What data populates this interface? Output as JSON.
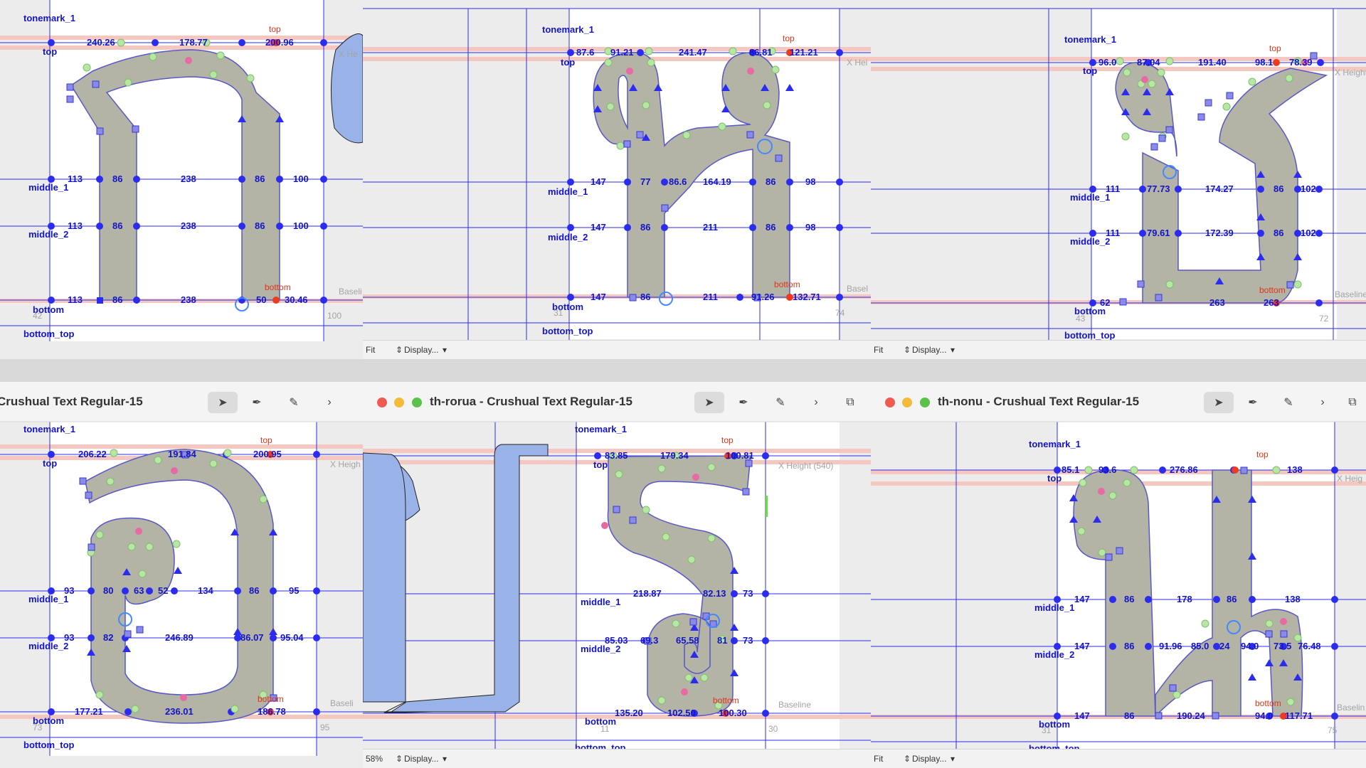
{
  "panels": [
    {
      "id": "p1",
      "has_titlebar": false,
      "guides": {
        "tonemark": "tonemark_1",
        "top": "top",
        "middle1": "middle_1",
        "middle2": "middle_2",
        "bottom": "bottom",
        "bottom_top": "bottom_top"
      },
      "anchor_labels": {
        "top": "top",
        "bottom": "bottom"
      },
      "metrics": [
        "240.26",
        "178.77",
        "200.96",
        "113",
        "86",
        "238",
        "86",
        "100",
        "113",
        "86",
        "238",
        "86",
        "100",
        "113",
        "86",
        "238",
        "50",
        "30.46"
      ],
      "side_labels": [
        "Baseli",
        "X He"
      ],
      "bottom_numbers": [
        "42",
        "100"
      ]
    },
    {
      "id": "p2",
      "has_titlebar": false,
      "guides": {
        "tonemark": "tonemark_1",
        "top": "top",
        "middle1": "middle_1",
        "middle2": "middle_2",
        "bottom": "bottom",
        "bottom_top": "bottom_top"
      },
      "anchor_labels": {
        "top": "top",
        "bottom": "bottom"
      },
      "metrics": [
        "87.6",
        "91.21",
        "241.47",
        "86.81",
        "121.21",
        "147",
        "77",
        "86.6",
        "164.19",
        "86",
        "98",
        "147",
        "86",
        "211",
        "86",
        "98",
        "147",
        "86",
        "211",
        "91.26",
        "132.71"
      ],
      "side_labels": [
        "X Hei",
        "Basel"
      ],
      "bottom_numbers": [
        "31",
        "74"
      ],
      "status": {
        "zoom": "Fit",
        "display": "Display..."
      }
    },
    {
      "id": "p3",
      "has_titlebar": false,
      "guides": {
        "tonemark": "tonemark_1",
        "top": "top",
        "middle1": "middle_1",
        "middle2": "middle_2",
        "bottom": "bottom",
        "bottom_top": "bottom_top"
      },
      "anchor_labels": {
        "top": "top",
        "bottom": "bottom"
      },
      "metrics": [
        "96.0",
        "87.04",
        "191.40",
        "98.1",
        "78.39",
        "111",
        "77.73",
        "174.27",
        "86",
        "102",
        "111",
        "79.61",
        "172.39",
        "86",
        "102",
        "62",
        "263",
        "263"
      ],
      "side_labels": [
        "X Height",
        "Baseline"
      ],
      "bottom_numbers": [
        "43",
        "72"
      ],
      "status": {
        "zoom": "Fit",
        "display": "Display..."
      }
    },
    {
      "id": "p4",
      "has_titlebar": true,
      "title": "Crushual Text Regular-15",
      "guides": {
        "tonemark": "tonemark_1",
        "top": "top",
        "middle1": "middle_1",
        "middle2": "middle_2",
        "bottom": "bottom",
        "bottom_top": "bottom_top"
      },
      "anchor_labels": {
        "top": "top",
        "bottom": "bottom"
      },
      "metrics": [
        "206.22",
        "191.84",
        "200.95",
        "93",
        "80",
        "63",
        "52",
        "134",
        "86",
        "95",
        "93",
        "82",
        "246.89",
        "86.07",
        "95.04",
        "177.21",
        "236.01",
        "186.78"
      ],
      "side_labels": [
        "X Heigh",
        "Baseli"
      ],
      "bottom_numbers": [
        "73",
        "95"
      ]
    },
    {
      "id": "p5",
      "has_titlebar": true,
      "title": "th-rorua - Crushual Text Regular-15",
      "guides": {
        "tonemark": "tonemark_1",
        "top": "top",
        "middle1": "middle_1",
        "middle2": "middle_2",
        "bottom": "bottom",
        "bottom_top": "bottom_top"
      },
      "anchor_labels": {
        "top": "top",
        "bottom": "bottom"
      },
      "metrics": [
        "83.85",
        "179.34",
        "100.81",
        "218.87",
        "82.13",
        "73",
        "85.03",
        "69.3",
        "65.58",
        "81",
        "73",
        "135.20",
        "102.50",
        "100.30"
      ],
      "side_labels": [
        "X Height (540)",
        "Baseline"
      ],
      "bottom_numbers": [
        "11",
        "30"
      ],
      "status": {
        "zoom": "58%",
        "display": "Display..."
      }
    },
    {
      "id": "p6",
      "has_titlebar": true,
      "title": "th-nonu - Crushual Text Regular-15",
      "guides": {
        "tonemark": "tonemark_1",
        "top": "top",
        "middle1": "middle_1",
        "middle2": "middle_2",
        "bottom": "bottom",
        "bottom_top": "bottom_top"
      },
      "anchor_labels": {
        "top": "top",
        "bottom": "bottom"
      },
      "metrics": [
        "85.1",
        "93.6",
        "276.86",
        "138",
        "147",
        "86",
        "178",
        "86",
        "138",
        "147",
        "86",
        "91.96",
        "85.0",
        "24",
        "94.0",
        "73.5",
        "76.48",
        "147",
        "86",
        "190.24",
        "94.0",
        "117.71"
      ],
      "side_labels": [
        "X Heig",
        "Baselin"
      ],
      "bottom_numbers": [
        "31",
        "75"
      ],
      "status": {
        "zoom": "Fit",
        "display": "Display..."
      }
    }
  ],
  "colors": {
    "guide_blue": "#2c2cf0",
    "glyph_fill": "#b3b3a6",
    "glyph_stroke": "#5858c8",
    "guide_band": "#f4c7c0",
    "canvas_white": "#ffffff",
    "neighbor_glyph": "#99b3e8",
    "handle_green": "#b8e6a4",
    "handle_pink": "#e86aa2",
    "anchor_red": "#ec3b1e",
    "label_blue": "#1414c8",
    "label_red": "#e0351a"
  },
  "icons": [
    "pointer-tool-icon",
    "pen-tool-icon",
    "pencil-tool-icon",
    "chevron-right-icon",
    "overlap-icon",
    "chevron-up-down-icon"
  ]
}
